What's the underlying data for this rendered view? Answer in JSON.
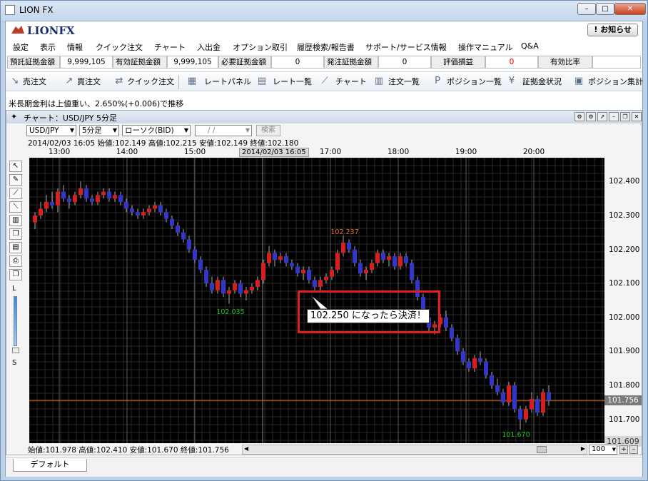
{
  "window": {
    "title": "LION FX",
    "controls": [
      "–",
      "□",
      "✕"
    ]
  },
  "brand": {
    "logo": "LIONFX",
    "notify": "! お知らせ"
  },
  "menu": [
    "設定",
    "表示",
    "情報",
    "クイック注文",
    "チャート",
    "入出金",
    "オプション取引",
    "履歴検索/報告書",
    "サポート/サービス情報",
    "操作マニュアル",
    "Q&A"
  ],
  "fields": {
    "deposit_label": "預託証拠金額",
    "deposit_value": "9,999,105",
    "valid_label": "有効証拠金額",
    "valid_value": "9,999,105",
    "required_label": "必要証拠金額",
    "required_value": "0",
    "order_label": "発注証拠金額",
    "order_value": "0",
    "pl_label": "評価損益",
    "pl_value": "0",
    "ratio_label": "有効比率",
    "ratio_value": ""
  },
  "toolbar": {
    "sell": "売注文",
    "buy": "買注文",
    "quick": "クイック注文",
    "rate_panel": "レートパネル",
    "rate_list": "レート一覧",
    "chart": "チャート",
    "order_list": "注文一覧",
    "position_list": "ポジション一覧",
    "margin": "証拠金状況",
    "position_sum": "ポジション集計"
  },
  "news": "米長期金利は上値重い、2.650%(+0.006)で推移",
  "chartwin": {
    "title": "チャート：USD/JPY 5分足",
    "pair": "USD/JPY",
    "timeframe": "5分足",
    "type": "ローソク(BID)",
    "date": "/ /",
    "search": "検索",
    "ohlc_top": "2014/02/03 16:05  始値:102.149    高値:102.215    安値:102.149    終値:102.180",
    "cursor_time": "2014/02/03 16:05",
    "ohlc_bottom": "始値:101.978     高値:102.410     安値:101.670     終値:101.756",
    "zoom": "100",
    "current_price": "101.756",
    "last_price": "101.609",
    "hi_label": "102.237",
    "lo_label1": "102.035",
    "lo_label2": "101.670",
    "annotation": "102.250 になったら決済！",
    "tool_L": "L",
    "tool_S": "S"
  },
  "tab": "デフォルト",
  "chart_data": {
    "type": "candlestick",
    "x_ticks": [
      "13:00",
      "14:00",
      "15:00",
      "16:00",
      "17:00",
      "18:00",
      "19:00",
      "20:00"
    ],
    "y_ticks": [
      102.4,
      102.3,
      102.2,
      102.1,
      102.0,
      101.9,
      101.8,
      101.7
    ],
    "ylim": [
      101.63,
      102.47
    ],
    "current_price": 101.756,
    "candles": [
      [
        102.28,
        102.31,
        102.26,
        102.3
      ],
      [
        102.3,
        102.34,
        102.29,
        102.32
      ],
      [
        102.32,
        102.36,
        102.31,
        102.34
      ],
      [
        102.34,
        102.37,
        102.32,
        102.33
      ],
      [
        102.33,
        102.38,
        102.31,
        102.37
      ],
      [
        102.37,
        102.39,
        102.34,
        102.35
      ],
      [
        102.35,
        102.36,
        102.32,
        102.34
      ],
      [
        102.34,
        102.37,
        102.33,
        102.36
      ],
      [
        102.36,
        102.4,
        102.35,
        102.38
      ],
      [
        102.38,
        102.39,
        102.34,
        102.35
      ],
      [
        102.35,
        102.36,
        102.33,
        102.34
      ],
      [
        102.34,
        102.37,
        102.33,
        102.36
      ],
      [
        102.36,
        102.38,
        102.35,
        102.37
      ],
      [
        102.37,
        102.38,
        102.34,
        102.35
      ],
      [
        102.35,
        102.37,
        102.34,
        102.36
      ],
      [
        102.36,
        102.37,
        102.33,
        102.34
      ],
      [
        102.34,
        102.35,
        102.31,
        102.32
      ],
      [
        102.32,
        102.33,
        102.3,
        102.31
      ],
      [
        102.31,
        102.32,
        102.29,
        102.3
      ],
      [
        102.3,
        102.32,
        102.29,
        102.31
      ],
      [
        102.31,
        102.33,
        102.3,
        102.32
      ],
      [
        102.32,
        102.34,
        102.31,
        102.33
      ],
      [
        102.33,
        102.34,
        102.3,
        102.31
      ],
      [
        102.31,
        102.32,
        102.28,
        102.29
      ],
      [
        102.29,
        102.3,
        102.26,
        102.27
      ],
      [
        102.27,
        102.28,
        102.24,
        102.25
      ],
      [
        102.25,
        102.26,
        102.22,
        102.23
      ],
      [
        102.23,
        102.24,
        102.19,
        102.2
      ],
      [
        102.2,
        102.21,
        102.16,
        102.17
      ],
      [
        102.17,
        102.18,
        102.13,
        102.14
      ],
      [
        102.14,
        102.15,
        102.09,
        102.1
      ],
      [
        102.1,
        102.12,
        102.07,
        102.08
      ],
      [
        102.08,
        102.12,
        102.07,
        102.11
      ],
      [
        102.11,
        102.12,
        102.06,
        102.07
      ],
      [
        102.07,
        102.09,
        102.04,
        102.08
      ],
      [
        102.08,
        102.11,
        102.07,
        102.1
      ],
      [
        102.1,
        102.11,
        102.06,
        102.07
      ],
      [
        102.07,
        102.09,
        102.05,
        102.08
      ],
      [
        102.08,
        102.1,
        102.07,
        102.09
      ],
      [
        102.09,
        102.12,
        102.08,
        102.11
      ],
      [
        102.11,
        102.17,
        102.1,
        102.16
      ],
      [
        102.16,
        102.21,
        102.15,
        102.19
      ],
      [
        102.19,
        102.2,
        102.15,
        102.17
      ],
      [
        102.17,
        102.19,
        102.16,
        102.18
      ],
      [
        102.18,
        102.19,
        102.15,
        102.16
      ],
      [
        102.16,
        102.17,
        102.14,
        102.15
      ],
      [
        102.15,
        102.16,
        102.12,
        102.13
      ],
      [
        102.13,
        102.15,
        102.11,
        102.14
      ],
      [
        102.14,
        102.15,
        102.1,
        102.11
      ],
      [
        102.11,
        102.12,
        102.08,
        102.09
      ],
      [
        102.09,
        102.12,
        102.08,
        102.11
      ],
      [
        102.11,
        102.13,
        102.1,
        102.12
      ],
      [
        102.12,
        102.15,
        102.11,
        102.14
      ],
      [
        102.14,
        102.2,
        102.13,
        102.19
      ],
      [
        102.19,
        102.24,
        102.18,
        102.22
      ],
      [
        102.22,
        102.23,
        102.19,
        102.2
      ],
      [
        102.2,
        102.21,
        102.15,
        102.16
      ],
      [
        102.16,
        102.17,
        102.12,
        102.13
      ],
      [
        102.13,
        102.15,
        102.11,
        102.14
      ],
      [
        102.14,
        102.17,
        102.13,
        102.16
      ],
      [
        102.16,
        102.2,
        102.15,
        102.19
      ],
      [
        102.19,
        102.2,
        102.16,
        102.17
      ],
      [
        102.17,
        102.19,
        102.15,
        102.18
      ],
      [
        102.18,
        102.19,
        102.14,
        102.15
      ],
      [
        102.15,
        102.19,
        102.14,
        102.18
      ],
      [
        102.18,
        102.19,
        102.15,
        102.16
      ],
      [
        102.16,
        102.17,
        102.1,
        102.11
      ],
      [
        102.11,
        102.12,
        102.05,
        102.06
      ],
      [
        102.06,
        102.07,
        101.99,
        102.0
      ],
      [
        102.0,
        102.02,
        101.96,
        101.97
      ],
      [
        101.97,
        101.99,
        101.95,
        101.98
      ],
      [
        101.98,
        102.01,
        101.97,
        102.0
      ],
      [
        102.0,
        102.02,
        101.96,
        101.97
      ],
      [
        101.97,
        101.98,
        101.93,
        101.94
      ],
      [
        101.94,
        101.95,
        101.89,
        101.9
      ],
      [
        101.9,
        101.91,
        101.86,
        101.87
      ],
      [
        101.87,
        101.88,
        101.84,
        101.85
      ],
      [
        101.85,
        101.89,
        101.84,
        101.88
      ],
      [
        101.88,
        101.9,
        101.86,
        101.87
      ],
      [
        101.87,
        101.88,
        101.82,
        101.83
      ],
      [
        101.83,
        101.84,
        101.79,
        101.8
      ],
      [
        101.8,
        101.82,
        101.77,
        101.78
      ],
      [
        101.78,
        101.79,
        101.74,
        101.75
      ],
      [
        101.75,
        101.81,
        101.74,
        101.8
      ],
      [
        101.8,
        101.81,
        101.72,
        101.73
      ],
      [
        101.73,
        101.74,
        101.67,
        101.7
      ],
      [
        101.7,
        101.74,
        101.69,
        101.73
      ],
      [
        101.73,
        101.78,
        101.72,
        101.76
      ],
      [
        101.76,
        101.77,
        101.71,
        101.72
      ],
      [
        101.72,
        101.79,
        101.71,
        101.78
      ],
      [
        101.78,
        101.8,
        101.74,
        101.756
      ]
    ]
  }
}
